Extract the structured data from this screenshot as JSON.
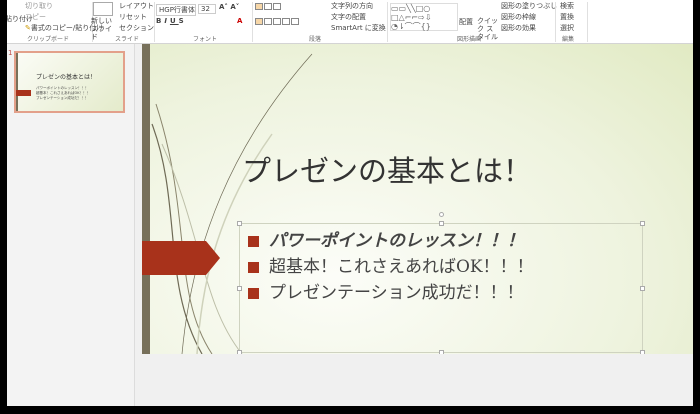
{
  "ribbon": {
    "clipboard": {
      "paste": "貼り付け",
      "cut": "切り取り",
      "copy": "コピー",
      "format_painter": "書式のコピー/貼り付け",
      "label": "クリップボード"
    },
    "slides": {
      "new_slide": "新しい スライド",
      "layout": "レイアウト",
      "reset": "リセット",
      "section": "セクション",
      "label": "スライド"
    },
    "font": {
      "name": "HGP行書体",
      "size": "32",
      "label": "フォント"
    },
    "paragraph": {
      "text_direction": "文字列の方向",
      "align_text": "文字の配置",
      "smartart": "SmartArt に変換",
      "label": "段落"
    },
    "drawing": {
      "arrange": "配置",
      "quick_styles": "クイック スタイル",
      "shape_fill": "図形の塗りつぶし",
      "shape_outline": "図形の枠線",
      "shape_effects": "図形の効果",
      "label": "図形描画"
    },
    "editing": {
      "find": "検索",
      "replace": "置換",
      "select": "選択",
      "label": "編集"
    }
  },
  "thumbnail": {
    "number": "1"
  },
  "slide": {
    "title": "プレゼンの基本とは！",
    "bullets": [
      "パワーポイントのレッスン！！！",
      "超基本！これさえあればOK！！！",
      "プレゼンテーション成功だ！！！"
    ]
  },
  "colors": {
    "accent": "#a8321b",
    "bar": "#77705a"
  }
}
